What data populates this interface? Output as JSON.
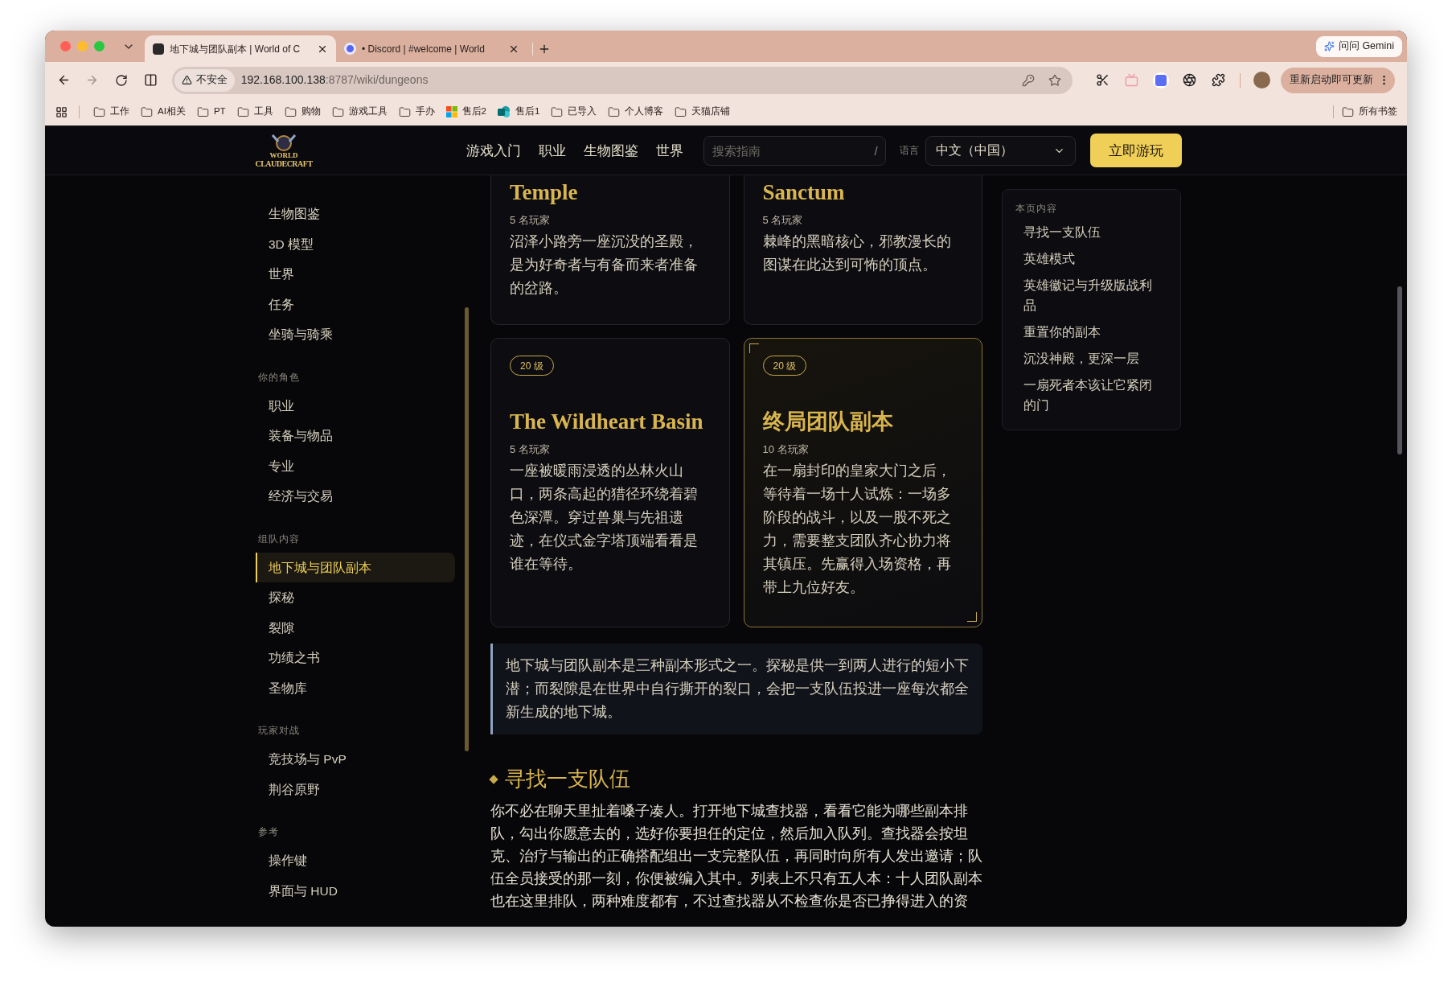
{
  "browser": {
    "tabs": [
      {
        "title": "地下城与团队副本 | World of C",
        "selected": true
      },
      {
        "title": "• Discord | #welcome | World",
        "selected": false
      }
    ],
    "gemini_button": "问问 Gemini",
    "address": {
      "security": "不安全",
      "host": "192.168.100.138",
      "path": ":8787/wiki/dungeons"
    },
    "update_button": "重新启动即可更新",
    "bookmarks": [
      {
        "label": "工作",
        "kind": "folder"
      },
      {
        "label": "AI相关",
        "kind": "folder"
      },
      {
        "label": "PT",
        "kind": "folder"
      },
      {
        "label": "工具",
        "kind": "folder"
      },
      {
        "label": "购物",
        "kind": "folder"
      },
      {
        "label": "游戏工具",
        "kind": "folder"
      },
      {
        "label": "手办",
        "kind": "folder"
      },
      {
        "label": "售后2",
        "kind": "tiles"
      },
      {
        "label": "售后1",
        "kind": "cloud"
      },
      {
        "label": "已导入",
        "kind": "folder"
      },
      {
        "label": "个人博客",
        "kind": "folder"
      },
      {
        "label": "天猫店铺",
        "kind": "folder"
      }
    ],
    "all_bookmarks": "所有书签"
  },
  "site": {
    "logo": [
      "WORLD",
      "CLAUDECRAFT"
    ],
    "nav": [
      "游戏入门",
      "职业",
      "生物图鉴",
      "世界"
    ],
    "search": {
      "placeholder": "搜索指南",
      "shortcut": "/"
    },
    "language": {
      "label": "语言",
      "value": "中文（中国）"
    },
    "play_button": "立即游玩"
  },
  "sidebar": {
    "sections": [
      {
        "items": [
          {
            "label": "生物图鉴",
            "selected": false
          },
          {
            "label": "3D 模型",
            "selected": false
          },
          {
            "label": "世界",
            "selected": false
          },
          {
            "label": "任务",
            "selected": false
          },
          {
            "label": "坐骑与骑乘",
            "selected": false
          }
        ]
      },
      {
        "title": "你的角色",
        "items": [
          {
            "label": "职业",
            "selected": false
          },
          {
            "label": "装备与物品",
            "selected": false
          },
          {
            "label": "专业",
            "selected": false
          },
          {
            "label": "经济与交易",
            "selected": false
          }
        ]
      },
      {
        "title": "组队内容",
        "items": [
          {
            "label": "地下城与团队副本",
            "selected": true
          },
          {
            "label": "探秘",
            "selected": false
          },
          {
            "label": "裂隙",
            "selected": false
          },
          {
            "label": "功绩之书",
            "selected": false
          },
          {
            "label": "圣物库",
            "selected": false
          }
        ]
      },
      {
        "title": "玩家对战",
        "items": [
          {
            "label": "竞技场与 PvP",
            "selected": false
          },
          {
            "label": "荆谷原野",
            "selected": false
          }
        ]
      },
      {
        "title": "参考",
        "items": [
          {
            "label": "操作键",
            "selected": false
          },
          {
            "label": "界面与 HUD",
            "selected": false
          }
        ]
      }
    ]
  },
  "cards": [
    {
      "title": "Temple",
      "players": "5 名玩家",
      "description": "沼泽小路旁一座沉没的圣殿，是为好奇者与有备而来者准备的岔路。",
      "highlighted": false
    },
    {
      "title": "Sanctum",
      "players": "5 名玩家",
      "description": "棘峰的黑暗核心，邪教漫长的图谋在此达到可怖的顶点。",
      "highlighted": false
    },
    {
      "badge": "20 级",
      "title": "The Wildheart Basin",
      "players": "5 名玩家",
      "description": "一座被暖雨浸透的丛林火山口，两条高起的猎径环绕着碧色深潭。穿过兽巢与先祖遗迹，在仪式金字塔顶端看看是谁在等待。",
      "highlighted": false
    },
    {
      "badge": "20 级",
      "title": "终局团队副本",
      "players": "10 名玩家",
      "description": "在一扇封印的皇家大门之后，等待着一场十人试炼：一场多阶段的战斗，以及一股不死之力，需要整支团队齐心协力将其镇压。先赢得入场资格，再带上九位好友。",
      "highlighted": true
    }
  ],
  "callout": "地下城与团队副本是三种副本形式之一。探秘是供一到两人进行的短小下潜；而裂隙是在世界中自行撕开的裂口，会把一支队伍投进一座每次都全新生成的地下城。",
  "sections": [
    {
      "heading": "寻找一支队伍",
      "paragraph": "你不必在聊天里扯着嗓子凑人。打开地下城查找器，看看它能为哪些副本排队，勾出你愿意去的，选好你要担任的定位，然后加入队列。查找器会按坦克、治疗与输出的正确搭配组出一支完整队伍，再同时向所有人发出邀请；队伍全员接受的那一刻，你便被编入其中。列表上不只有五人本：十人团队副本也在这里排队，两种难度都有，不过查找器从不检查你是否已挣得进入的资"
    }
  ],
  "toc": {
    "title": "本页内容",
    "items": [
      "寻找一支队伍",
      "英雄模式",
      "英雄徽记与升级版战利品",
      "重置你的副本",
      "沉没神殿，更深一层",
      "一扇死者本该让它紧闭的门"
    ]
  }
}
